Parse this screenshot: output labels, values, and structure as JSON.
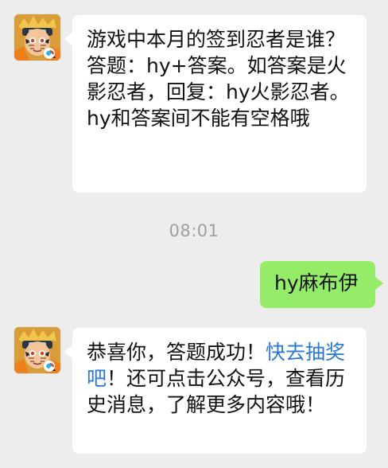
{
  "chat": {
    "timestamp": "08:01",
    "messages": [
      {
        "side": "left",
        "text": "游戏中本月的签到忍者是谁？答题：hy+答案。如答案是火影忍者，回复：hy火影忍者。hy和答案间不能有空格哦"
      },
      {
        "side": "right",
        "text": "hy麻布伊"
      },
      {
        "side": "left",
        "prefix": "恭喜你，答题成功！",
        "link": "快去抽奖吧",
        "suffix": "！还可点击公众号，查看历史消息，了解更多内容哦！"
      }
    ]
  },
  "colors": {
    "background": "#ededed",
    "incoming_bubble": "#ffffff",
    "outgoing_bubble": "#95ec69",
    "link": "#2a78d0",
    "timestamp": "#a0a0a0"
  },
  "icons": {
    "avatar": "naruto-avatar-icon"
  }
}
